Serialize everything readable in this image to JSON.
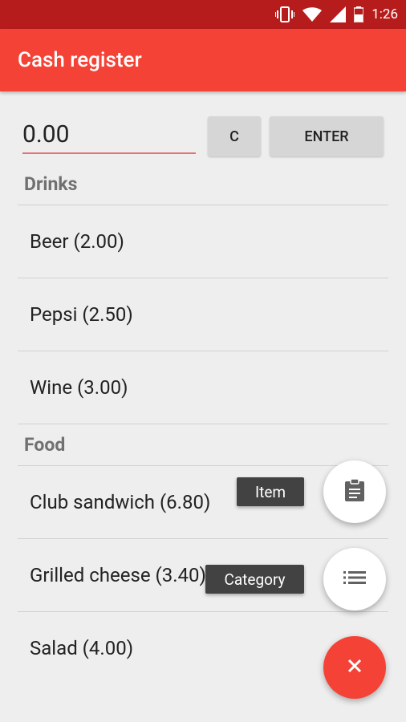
{
  "status_bar": {
    "time": "1:26"
  },
  "app_bar": {
    "title": "Cash register"
  },
  "input": {
    "value": "0.00"
  },
  "buttons": {
    "clear": "C",
    "enter": "ENTER"
  },
  "sections": [
    {
      "header": "Drinks",
      "items": [
        "Beer (2.00)",
        "Pepsi (2.50)",
        "Wine (3.00)"
      ]
    },
    {
      "header": "Food",
      "items": [
        "Club sandwich (6.80)",
        "Grilled cheese (3.40)",
        "Salad (4.00)"
      ]
    }
  ],
  "fab_menu": {
    "item_label": "Item",
    "category_label": "Category"
  },
  "colors": {
    "primary": "#f44336",
    "primary_dark": "#b71c1c",
    "background": "#eeeeee"
  },
  "icons": {
    "add_item": "clipboard-icon",
    "add_category": "list-icon",
    "close": "close-icon"
  }
}
